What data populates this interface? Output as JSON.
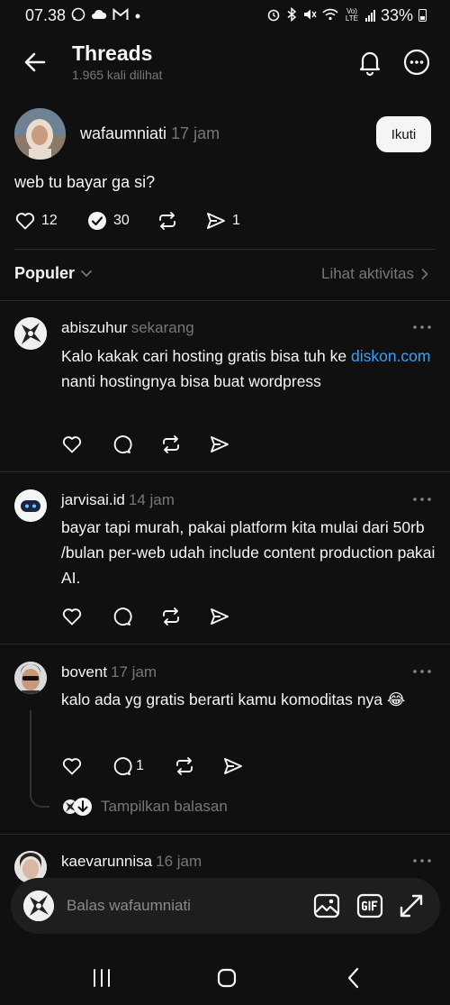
{
  "status_bar": {
    "time": "07.38",
    "battery": "33%",
    "network": "Vo) LTE"
  },
  "header": {
    "title": "Threads",
    "subtitle": "1.965 kali dilihat"
  },
  "post": {
    "username": "wafaumniati",
    "time": "17 jam",
    "follow_label": "Ikuti",
    "text": "web tu bayar ga si?",
    "likes": "12",
    "replies": "30",
    "shares": "1"
  },
  "sort": {
    "label": "Populer",
    "activity_label": "Lihat aktivitas"
  },
  "replies": [
    {
      "username": "abiszuhur",
      "time": "sekarang",
      "text_before": "Kalo kakak cari hosting gratis bisa tuh ke ",
      "link": "diskon.com",
      "text_after": " nanti hostingnya bisa buat wordpress"
    },
    {
      "username": "jarvisai.id",
      "time": "14 jam",
      "text": "bayar tapi murah, pakai platform kita mulai dari 50rb /bulan per-web udah include content production pakai AI."
    },
    {
      "username": "bovent",
      "time": "17 jam",
      "text": "kalo ada yg gratis berarti kamu komoditas nya 😂",
      "reply_count": "1",
      "show_replies_label": "Tampilkan balasan"
    },
    {
      "username": "kaevarunnisa",
      "time": "16 jam"
    }
  ],
  "composer": {
    "placeholder": "Balas wafaumniati"
  },
  "colors": {
    "background": "#101010",
    "text": "#f3f5f7",
    "secondary": "#777777",
    "link": "#3d9ff2",
    "composer_bg": "#1e1e1e"
  }
}
